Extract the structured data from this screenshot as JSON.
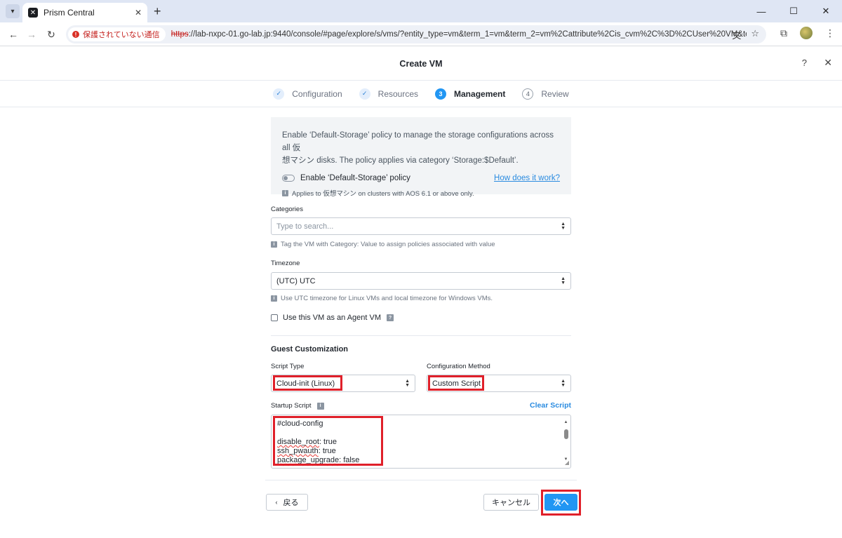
{
  "browser": {
    "tab_title": "Prism Central",
    "new_tab": "+",
    "security_label": "保護されていない通信",
    "url_scheme": "https",
    "url_rest": "://lab-nxpc-01.go-lab.jp:9440/console/#page/explore/s/vms/?entity_type=vm&term_1=vm&term_2=vm%2Cattribute%2Cis_cvm%2C%3D%2CUser%20VM&term_3=..."
  },
  "modal": {
    "title": "Create VM",
    "help": "?",
    "close": "✕"
  },
  "steps": [
    {
      "label": "Configuration",
      "marker": "✓",
      "state": "done"
    },
    {
      "label": "Resources",
      "marker": "✓",
      "state": "done"
    },
    {
      "label": "Management",
      "marker": "3",
      "state": "active"
    },
    {
      "label": "Review",
      "marker": "4",
      "state": "todo"
    }
  ],
  "storage_policy": {
    "description_line1": "Enable ‘Default-Storage’ policy to manage the storage configurations across all 仮",
    "description_line2": "想マシン disks. The policy applies via category ‘Storage:$Default’.",
    "toggle_label": "Enable ‘Default-Storage’ policy",
    "toggle_on": false,
    "link": "How does it work?",
    "note": "Applies to 仮想マシン on clusters with AOS 6.1 or above only."
  },
  "categories": {
    "label": "Categories",
    "placeholder": "Type to search...",
    "hint": "Tag the VM with Category: Value to assign policies associated with value"
  },
  "timezone": {
    "label": "Timezone",
    "value": "(UTC) UTC",
    "hint": "Use UTC timezone for Linux VMs and local timezone for Windows VMs."
  },
  "agent_vm": {
    "label": "Use this VM as an Agent VM",
    "checked": false
  },
  "guest_customization": {
    "title": "Guest Customization",
    "script_type_label": "Script Type",
    "script_type_value": "Cloud-init (Linux)",
    "config_method_label": "Configuration Method",
    "config_method_value": "Custom Script",
    "startup_script_label": "Startup Script",
    "clear_script": "Clear Script",
    "script_lines": [
      "#cloud-config",
      "",
      "disable_root: true",
      "ssh_pwauth: true",
      "package_upgrade: false"
    ]
  },
  "footer": {
    "back": "戻る",
    "cancel": "キャンセル",
    "next": "次へ"
  },
  "colors": {
    "primary": "#2196f3",
    "link": "#2a8be0",
    "highlight": "#e0202a"
  }
}
